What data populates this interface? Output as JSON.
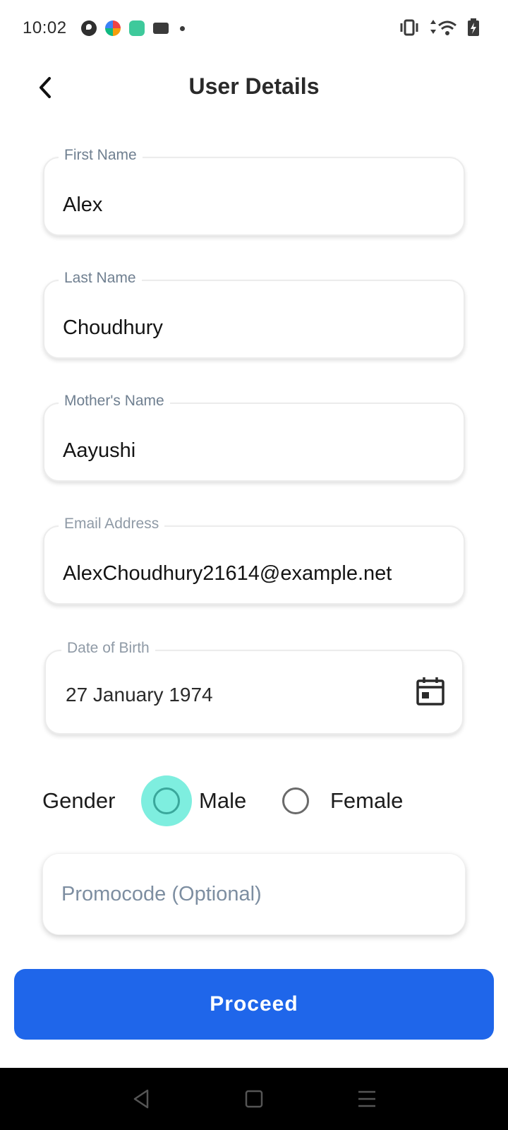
{
  "status_bar": {
    "time": "10:02",
    "notification_icons": [
      "app-icon-p",
      "photos-icon",
      "calculator-icon",
      "news-icon"
    ]
  },
  "header": {
    "title": "User Details"
  },
  "form": {
    "first_name": {
      "label": "First Name",
      "value": "Alex"
    },
    "last_name": {
      "label": "Last Name",
      "value": "Choudhury"
    },
    "mother_name": {
      "label": "Mother's Name",
      "value": "Aayushi"
    },
    "email": {
      "label": "Email Address",
      "value": "AlexChoudhury21614@example.net"
    },
    "dob": {
      "label": "Date of Birth",
      "value": "27 January 1974"
    },
    "gender": {
      "label": "Gender",
      "options": [
        "Male",
        "Female"
      ],
      "focused": "Male"
    },
    "promocode": {
      "placeholder": "Promocode (Optional)",
      "value": ""
    }
  },
  "actions": {
    "proceed_label": "Proceed"
  },
  "colors": {
    "primary": "#1f66ea",
    "radio_focus_halo": "#7eeedf",
    "label_gray": "#6f7f90"
  }
}
